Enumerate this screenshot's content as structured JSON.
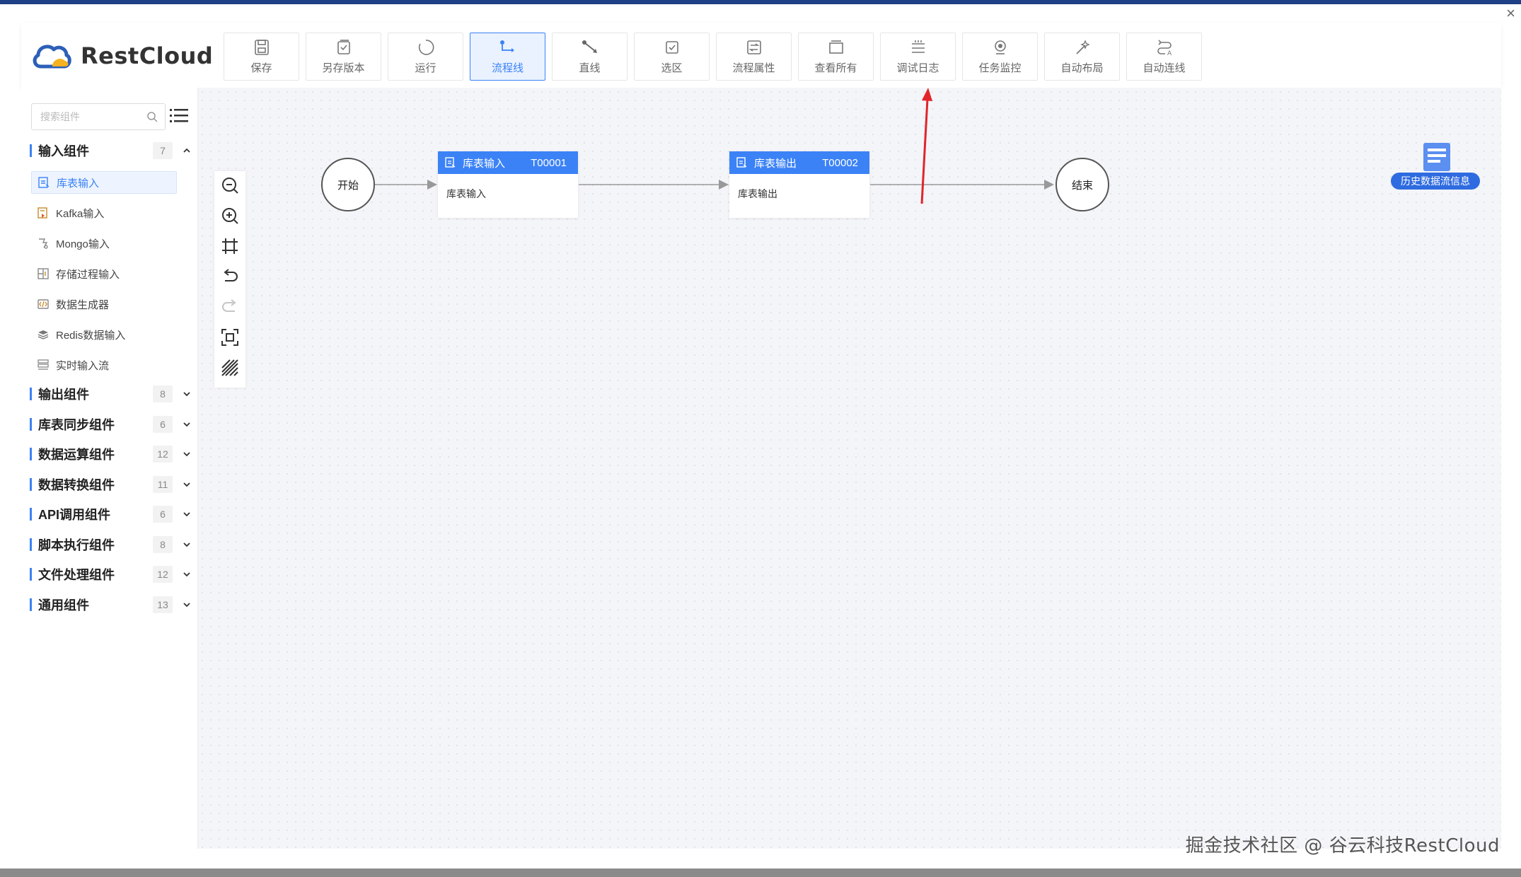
{
  "window": {
    "close_icon": "×"
  },
  "brand": {
    "name": "RestCloud"
  },
  "toolbar": [
    {
      "label": "保存",
      "icon": "save-icon"
    },
    {
      "label": "另存版本",
      "icon": "save-version-icon"
    },
    {
      "label": "运行",
      "icon": "run-icon"
    },
    {
      "label": "流程线",
      "icon": "flow-line-icon",
      "active": true
    },
    {
      "label": "直线",
      "icon": "straight-line-icon"
    },
    {
      "label": "选区",
      "icon": "select-area-icon"
    },
    {
      "label": "流程属性",
      "icon": "flow-properties-icon"
    },
    {
      "label": "查看所有",
      "icon": "view-all-icon"
    },
    {
      "label": "调试日志",
      "icon": "debug-log-icon"
    },
    {
      "label": "任务监控",
      "icon": "task-monitor-icon"
    },
    {
      "label": "自动布局",
      "icon": "auto-layout-icon"
    },
    {
      "label": "自动连线",
      "icon": "auto-connect-icon"
    }
  ],
  "sidebar": {
    "search_placeholder": "搜索组件",
    "groups": [
      {
        "label": "输入组件",
        "count": "7",
        "expanded": true,
        "items": [
          {
            "label": "库表输入",
            "selected": true
          },
          {
            "label": "Kafka输入"
          },
          {
            "label": "Mongo输入"
          },
          {
            "label": "存储过程输入"
          },
          {
            "label": "数据生成器"
          },
          {
            "label": "Redis数据输入"
          },
          {
            "label": "实时输入流"
          }
        ]
      },
      {
        "label": "输出组件",
        "count": "8"
      },
      {
        "label": "库表同步组件",
        "count": "6"
      },
      {
        "label": "数据运算组件",
        "count": "12"
      },
      {
        "label": "数据转换组件",
        "count": "11"
      },
      {
        "label": "API调用组件",
        "count": "6"
      },
      {
        "label": "脚本执行组件",
        "count": "8"
      },
      {
        "label": "文件处理组件",
        "count": "12"
      },
      {
        "label": "通用组件",
        "count": "13"
      }
    ]
  },
  "canvas": {
    "start_label": "开始",
    "end_label": "结束",
    "nodes": [
      {
        "title": "库表输入",
        "id": "T00001",
        "body": "库表输入"
      },
      {
        "title": "库表输出",
        "id": "T00002",
        "body": "库表输出"
      }
    ],
    "history_label": "历史数据流信息"
  },
  "colors": {
    "accent": "#3b82f6",
    "arrow": "#e0262a",
    "header_bar": "#1f3f86"
  },
  "watermark": "掘金技术社区 @ 谷云科技RestCloud"
}
